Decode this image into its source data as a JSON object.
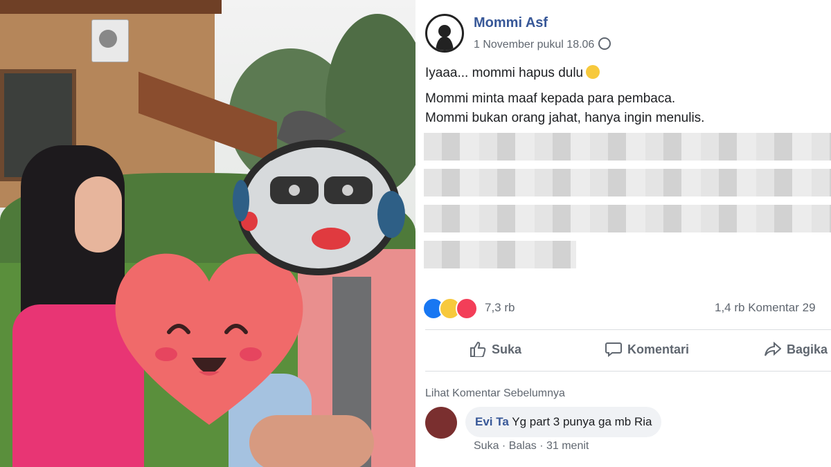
{
  "post": {
    "author": "Mommi Asf",
    "timestamp": "1 November pukul 18.06",
    "privacy_icon": "globe-icon",
    "text_line1": "Iyaaa... mommi hapus dulu",
    "text_line2": "Mommi minta maaf kepada para pembaca.",
    "text_line3": "Mommi bukan orang jahat, hanya ingin menulis.",
    "reaction_count": "7,3 rb",
    "comment_share_count": "1,4 rb Komentar  29",
    "reactions": [
      "like",
      "sad",
      "love"
    ]
  },
  "actions": {
    "like": "Suka",
    "comment": "Komentari",
    "share": "Bagika"
  },
  "comments": {
    "view_previous": "Lihat Komentar Sebelumnya",
    "items": [
      {
        "author": "Evi Ta",
        "text": "Yg part 3 punya ga mb Ria",
        "like": "Suka",
        "reply": "Balas",
        "time": "31 menit"
      }
    ]
  },
  "colors": {
    "link_blue": "#385898",
    "heart_sticker": "#f06a6a",
    "like_blue": "#1877f2",
    "love_red": "#f33e58"
  }
}
